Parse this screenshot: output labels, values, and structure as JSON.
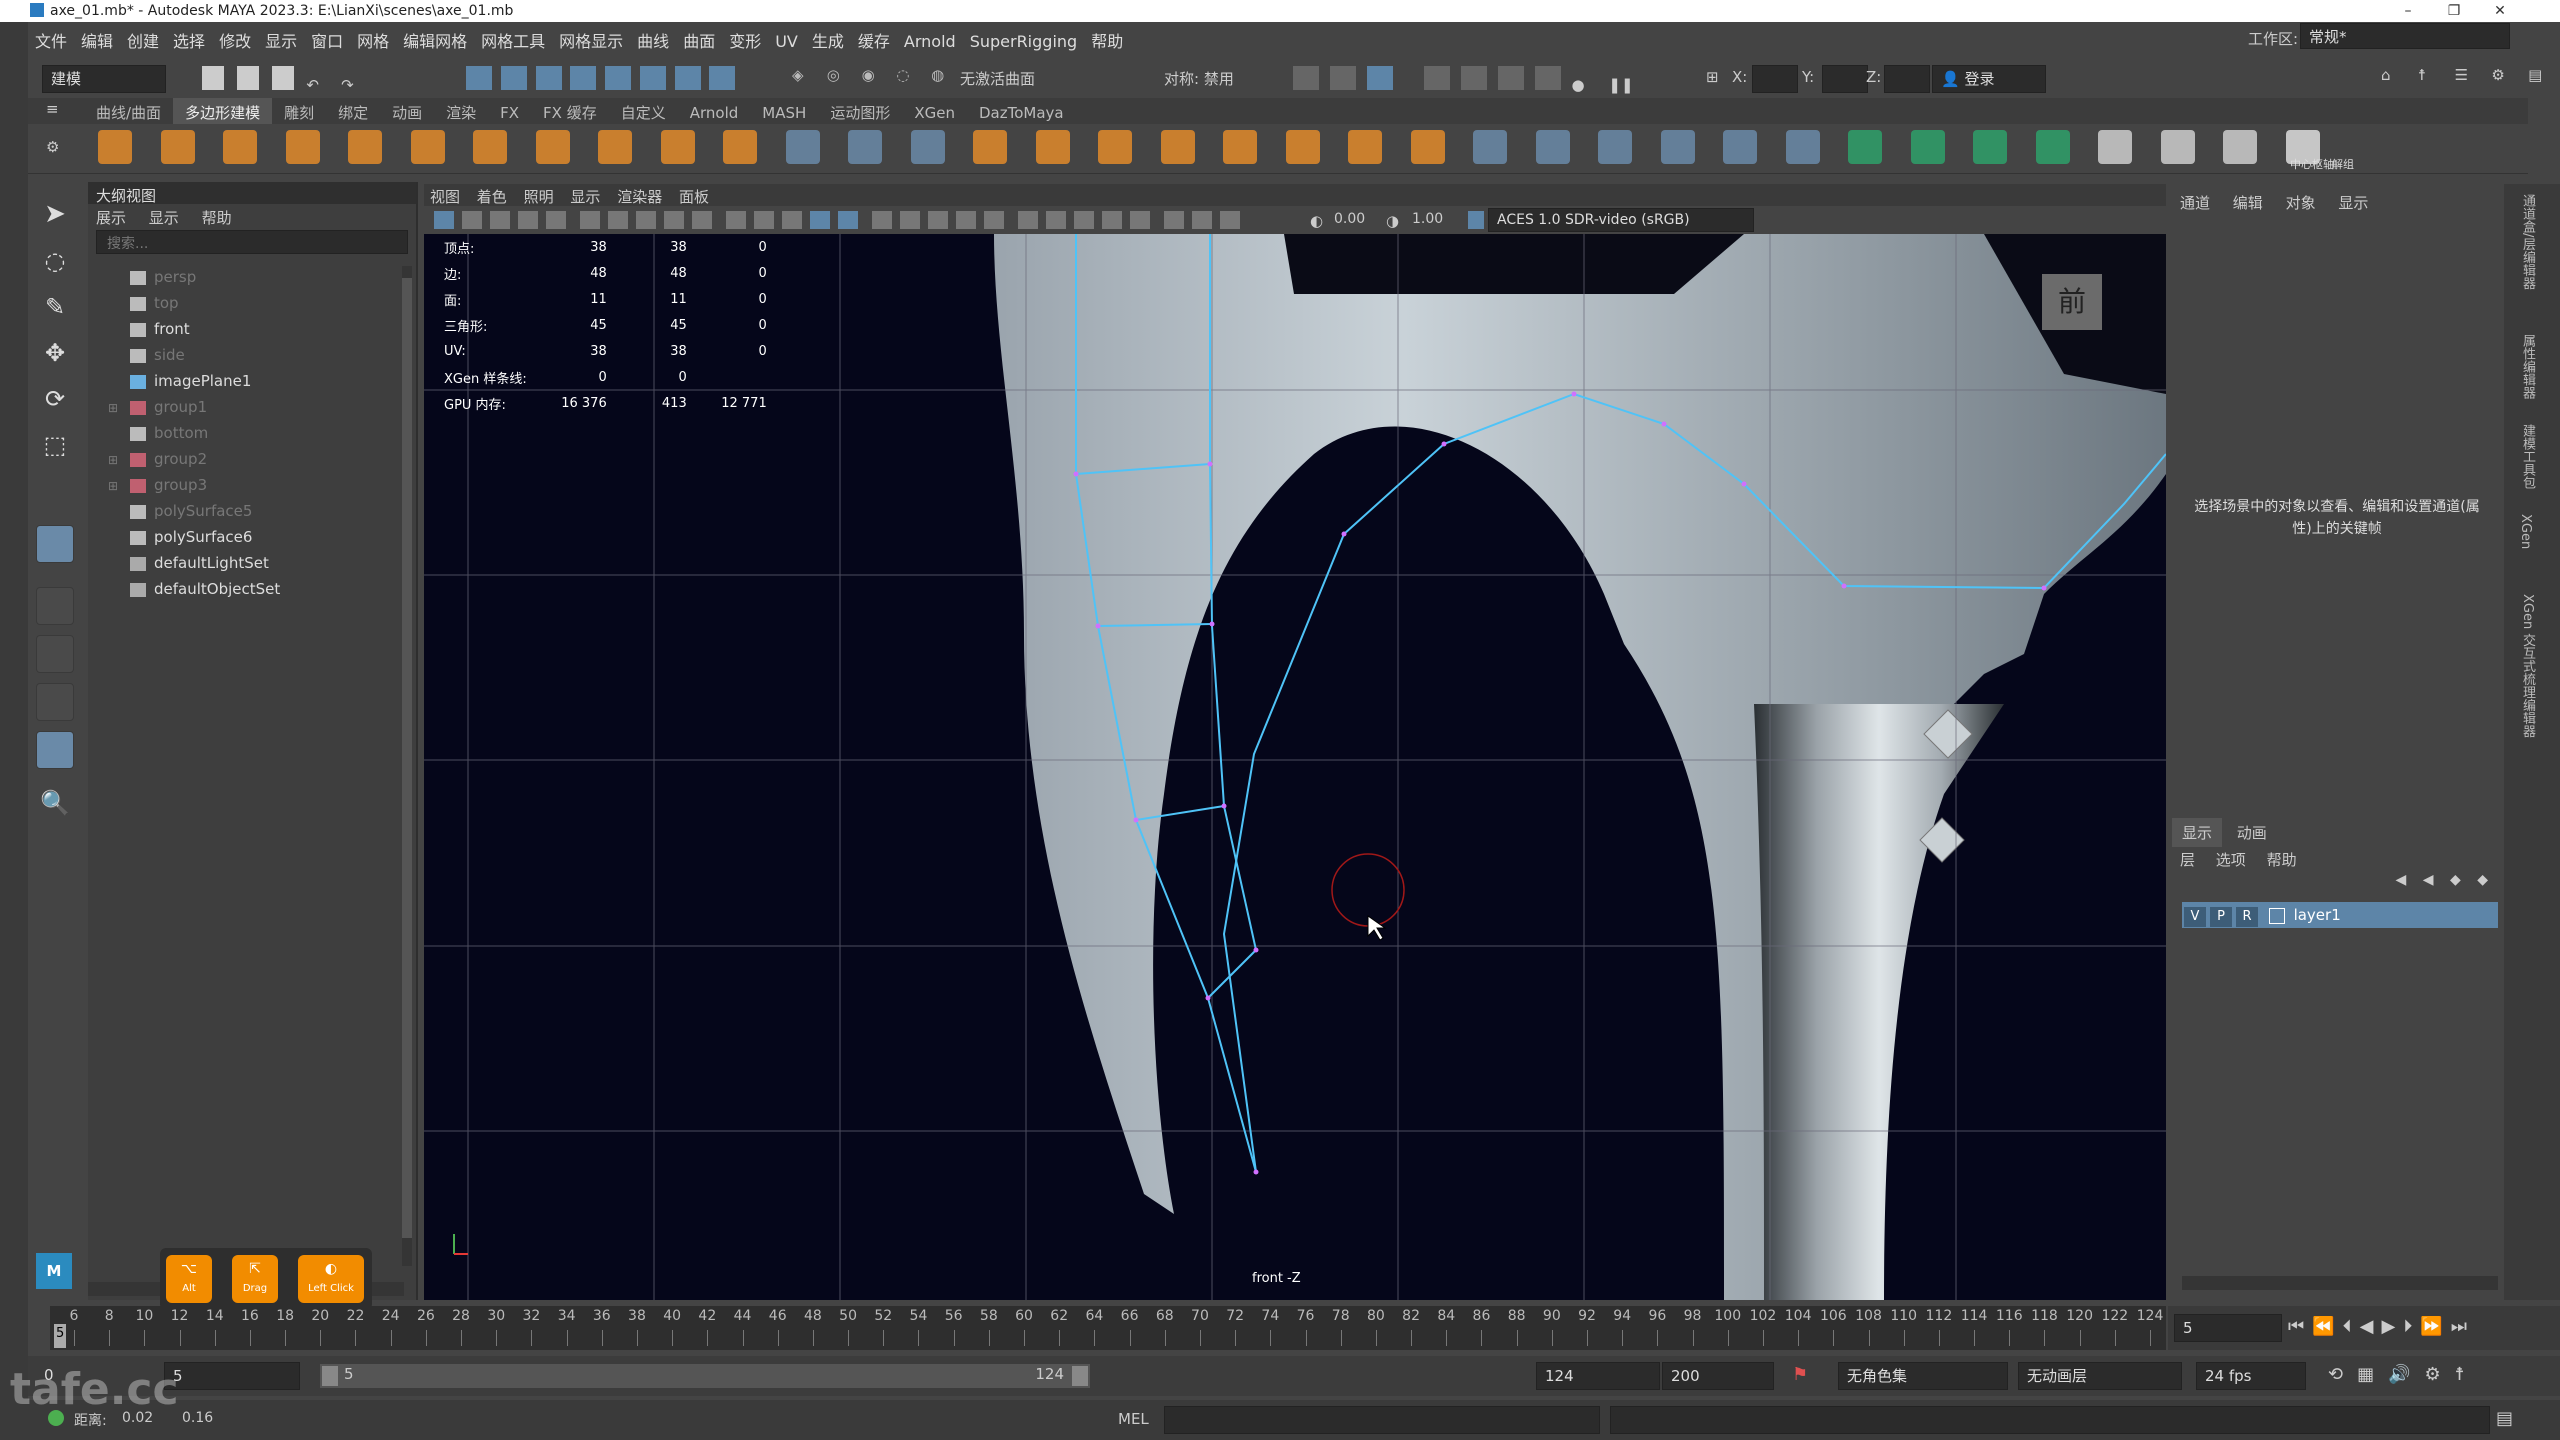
{
  "titlebar": {
    "title": "axe_01.mb* - Autodesk MAYA 2023.3: E:\\LianXi\\scenes\\axe_01.mb"
  },
  "menubar": {
    "items": [
      "文件",
      "编辑",
      "创建",
      "选择",
      "修改",
      "显示",
      "窗口",
      "网格",
      "编辑网格",
      "网格工具",
      "网格显示",
      "曲线",
      "曲面",
      "变形",
      "UV",
      "生成",
      "缓存",
      "Arnold",
      "SuperRigging",
      "帮助"
    ],
    "workspace_label": "工作区:",
    "workspace_value": "常规*"
  },
  "statusline": {
    "mode": "建模",
    "live_surface": "无激活曲面",
    "symmetry": "对称: 禁用",
    "x_label": "X:",
    "y_label": "Y:",
    "z_label": "Z:",
    "login": "登录"
  },
  "shelf": {
    "tabs": [
      "曲线/曲面",
      "多边形建模",
      "雕刻",
      "绑定",
      "动画",
      "渲染",
      "FX",
      "FX 缓存",
      "自定义",
      "Arnold",
      "MASH",
      "运动图形",
      "XGen",
      "DazToMaya"
    ],
    "active_tab": "多边形建模",
    "right_labels": [
      "中心枢轴",
      "解组"
    ]
  },
  "outliner": {
    "title": "大纲视图",
    "menu": [
      "展示",
      "显示",
      "帮助"
    ],
    "search_placeholder": "搜索...",
    "items": [
      {
        "label": "persp",
        "dim": true,
        "expand": false,
        "icon": "camera"
      },
      {
        "label": "top",
        "dim": true,
        "expand": false,
        "icon": "camera"
      },
      {
        "label": "front",
        "dim": false,
        "expand": false,
        "icon": "camera"
      },
      {
        "label": "side",
        "dim": true,
        "expand": false,
        "icon": "camera"
      },
      {
        "label": "imagePlane1",
        "dim": false,
        "expand": false,
        "icon": "image"
      },
      {
        "label": "group1",
        "dim": true,
        "expand": true,
        "icon": "group"
      },
      {
        "label": "bottom",
        "dim": true,
        "expand": false,
        "icon": "camera"
      },
      {
        "label": "group2",
        "dim": true,
        "expand": true,
        "icon": "group"
      },
      {
        "label": "group3",
        "dim": true,
        "expand": true,
        "icon": "group"
      },
      {
        "label": "polySurface5",
        "dim": true,
        "expand": false,
        "icon": "mesh"
      },
      {
        "label": "polySurface6",
        "dim": false,
        "expand": false,
        "icon": "mesh"
      },
      {
        "label": "defaultLightSet",
        "dim": false,
        "expand": false,
        "icon": "set"
      },
      {
        "label": "defaultObjectSet",
        "dim": false,
        "expand": false,
        "icon": "set"
      }
    ]
  },
  "viewport": {
    "menu": [
      "视图",
      "着色",
      "照明",
      "显示",
      "渲染器",
      "面板"
    ],
    "exposure": "0.00",
    "gamma": "1.00",
    "color_space": "ACES 1.0 SDR-video (sRGB)",
    "viewcube_label": "前",
    "camera_label": "front -Z",
    "hud": [
      {
        "label": "顶点:",
        "a": "38",
        "b": "38",
        "c": "0"
      },
      {
        "label": "边:",
        "a": "48",
        "b": "48",
        "c": "0"
      },
      {
        "label": "面:",
        "a": "11",
        "b": "11",
        "c": "0"
      },
      {
        "label": "三角形:",
        "a": "45",
        "b": "45",
        "c": "0"
      },
      {
        "label": "UV:",
        "a": "38",
        "b": "38",
        "c": "0"
      },
      {
        "label": "XGen 样条线:",
        "a": "0",
        "b": "0",
        "c": ""
      },
      {
        "label": "GPU 内存:",
        "a": "16 376",
        "b": "413",
        "c": "12 771"
      }
    ]
  },
  "channelbox": {
    "menu": [
      "通道",
      "编辑",
      "对象",
      "显示"
    ],
    "info": "选择场景中的对象以查看、编辑和设置通道(属性)上的关键帧"
  },
  "layers": {
    "tabs": [
      "显示",
      "动画"
    ],
    "menu": [
      "层",
      "选项",
      "帮助"
    ],
    "layer_name": "layer1",
    "v": "V",
    "p": "P",
    "r": "R"
  },
  "right_strip": [
    "通道盒/层编辑器",
    "属性编辑器",
    "建模工具包",
    "XGen",
    "XGen 交互式梳理编辑器"
  ],
  "timeslider": {
    "current_frame": "5",
    "current_frame_marker": "5",
    "ticks": [
      "6",
      "8",
      "10",
      "12",
      "14",
      "16",
      "18",
      "20",
      "22",
      "24",
      "26",
      "28",
      "30",
      "32",
      "34",
      "36",
      "38",
      "40",
      "42",
      "44",
      "46",
      "48",
      "50",
      "52",
      "54",
      "56",
      "58",
      "60",
      "62",
      "64",
      "66",
      "68",
      "70",
      "72",
      "74",
      "76",
      "78",
      "80",
      "82",
      "84",
      "86",
      "88",
      "90",
      "92",
      "94",
      "96",
      "98",
      "100",
      "102",
      "104",
      "106",
      "108",
      "110",
      "112",
      "114",
      "116",
      "118",
      "120",
      "122",
      "124"
    ]
  },
  "range": {
    "start": "0",
    "anim_start": "5",
    "range_start": "5",
    "range_end": "124",
    "anim_end": "124",
    "max_end": "200",
    "char_set": "无角色集",
    "anim_layer": "无动画层",
    "fps": "24 fps"
  },
  "cmdline": {
    "distance_label": "距离:",
    "distance_a": "0.02",
    "distance_b": "0.16",
    "mel": "MEL"
  },
  "hotkeys": [
    {
      "icon": "⌥",
      "label": "Alt"
    },
    {
      "icon": "⇱",
      "label": "Drag"
    },
    {
      "icon": "◐",
      "label": "Left Click"
    }
  ],
  "watermark": "tafe.cc",
  "colors": {
    "accent": "#5d85a8",
    "wireframe": "#4fc3f7",
    "viewport_bg": "#05061a",
    "hotkey": "#f28c00"
  }
}
